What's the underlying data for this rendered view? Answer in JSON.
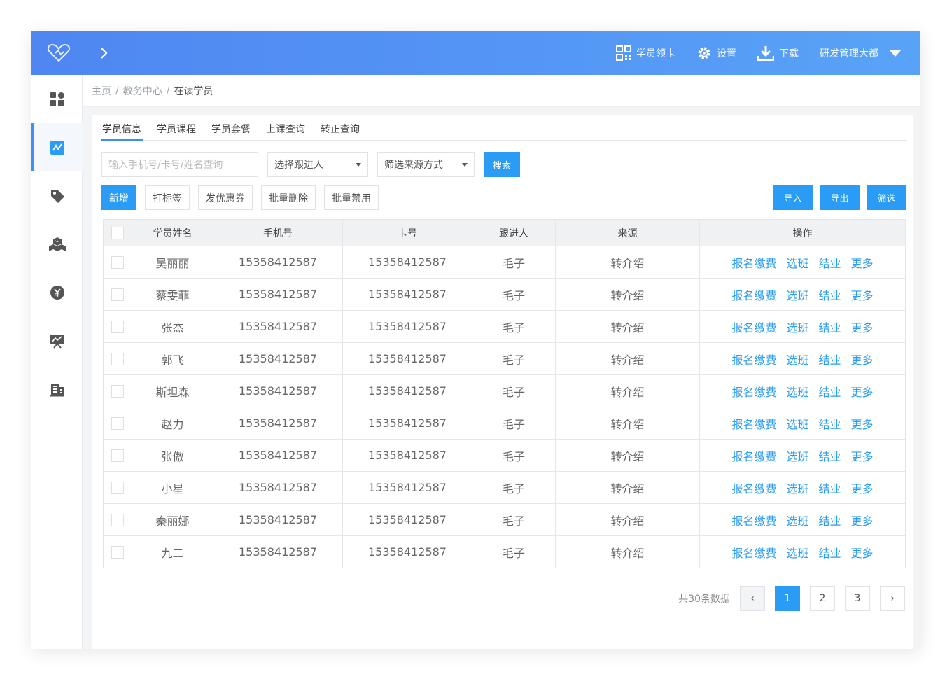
{
  "header": {
    "actions": [
      {
        "icon": "qr-code-icon",
        "label": "学员领卡"
      },
      {
        "icon": "gear-icon",
        "label": "设置"
      },
      {
        "icon": "download-icon",
        "label": "下载"
      }
    ],
    "user": "研发管理大都"
  },
  "sidebar": {
    "items": [
      {
        "icon": "dashboard-icon",
        "active": false
      },
      {
        "icon": "student-chart-icon",
        "active": true
      },
      {
        "icon": "tag-icon",
        "active": false
      },
      {
        "icon": "boxes-icon",
        "active": false
      },
      {
        "icon": "yen-coin-icon",
        "active": false
      },
      {
        "icon": "presentation-icon",
        "active": false
      },
      {
        "icon": "building-icon",
        "active": false
      }
    ]
  },
  "breadcrumb": {
    "items": [
      "主页",
      "教务中心"
    ],
    "separator": "/",
    "current": "在读学员"
  },
  "tabs": [
    "学员信息",
    "学员课程",
    "学员套餐",
    "上课查询",
    "转正查询"
  ],
  "filters": {
    "search_placeholder": "输入手机号/卡号/姓名查询",
    "follower_select": "选择跟进人",
    "source_select": "筛选来源方式",
    "search_button": "搜索"
  },
  "toolbar": {
    "left": [
      "新增",
      "打标签",
      "发优惠券",
      "批量删除",
      "批量禁用"
    ],
    "right": [
      "导入",
      "导出",
      "筛选"
    ]
  },
  "table": {
    "columns": [
      "学员姓名",
      "手机号",
      "卡号",
      "跟进人",
      "来源",
      "操作"
    ],
    "rows": [
      {
        "name": "吴丽丽",
        "phone": "15358412587",
        "card": "15358412587",
        "follower": "毛子",
        "source": "转介绍"
      },
      {
        "name": "蔡雯菲",
        "phone": "15358412587",
        "card": "15358412587",
        "follower": "毛子",
        "source": "转介绍"
      },
      {
        "name": "张杰",
        "phone": "15358412587",
        "card": "15358412587",
        "follower": "毛子",
        "source": "转介绍"
      },
      {
        "name": "郭飞",
        "phone": "15358412587",
        "card": "15358412587",
        "follower": "毛子",
        "source": "转介绍"
      },
      {
        "name": "斯坦森",
        "phone": "15358412587",
        "card": "15358412587",
        "follower": "毛子",
        "source": "转介绍"
      },
      {
        "name": "赵力",
        "phone": "15358412587",
        "card": "15358412587",
        "follower": "毛子",
        "source": "转介绍"
      },
      {
        "name": "张傲",
        "phone": "15358412587",
        "card": "15358412587",
        "follower": "毛子",
        "source": "转介绍"
      },
      {
        "name": "小星",
        "phone": "15358412587",
        "card": "15358412587",
        "follower": "毛子",
        "source": "转介绍"
      },
      {
        "name": "秦丽娜",
        "phone": "15358412587",
        "card": "15358412587",
        "follower": "毛子",
        "source": "转介绍"
      },
      {
        "name": "九二",
        "phone": "15358412587",
        "card": "15358412587",
        "follower": "毛子",
        "source": "转介绍"
      }
    ],
    "row_actions": [
      "报名缴费",
      "选班",
      "结业",
      "更多"
    ]
  },
  "pagination": {
    "total_text": "共30条数据",
    "pages": [
      "1",
      "2",
      "3"
    ],
    "current": "1",
    "prev_symbol": "‹",
    "next_symbol": "›"
  },
  "colors": {
    "header_gradient_start": "#4f86f2",
    "header_gradient_end": "#58a3f7",
    "primary": "#2a9cf5",
    "sidebar_active": "#3b8ff5"
  }
}
